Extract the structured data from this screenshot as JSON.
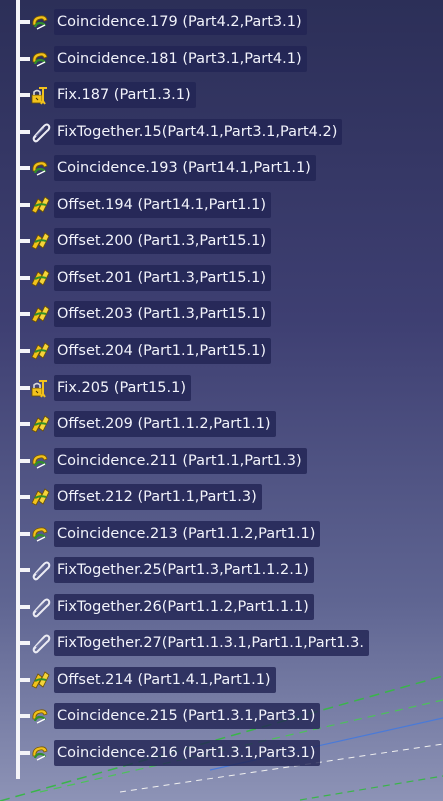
{
  "tree": {
    "items": [
      {
        "type": "coincidence",
        "label": "Coincidence.179 (Part4.2,Part3.1)"
      },
      {
        "type": "coincidence",
        "label": "Coincidence.181 (Part3.1,Part4.1)"
      },
      {
        "type": "fix",
        "label": "Fix.187 (Part1.3.1)"
      },
      {
        "type": "fixtogether",
        "label": "FixTogether.15(Part4.1,Part3.1,Part4.2)"
      },
      {
        "type": "coincidence",
        "label": "Coincidence.193 (Part14.1,Part1.1)"
      },
      {
        "type": "offset",
        "label": "Offset.194 (Part14.1,Part1.1)"
      },
      {
        "type": "offset",
        "label": "Offset.200 (Part1.3,Part15.1)"
      },
      {
        "type": "offset",
        "label": "Offset.201 (Part1.3,Part15.1)"
      },
      {
        "type": "offset",
        "label": "Offset.203 (Part1.3,Part15.1)"
      },
      {
        "type": "offset",
        "label": "Offset.204 (Part1.1,Part15.1)"
      },
      {
        "type": "fix",
        "label": "Fix.205 (Part15.1)"
      },
      {
        "type": "offset",
        "label": "Offset.209 (Part1.1.2,Part1.1)"
      },
      {
        "type": "coincidence",
        "label": "Coincidence.211 (Part1.1,Part1.3)"
      },
      {
        "type": "offset",
        "label": "Offset.212 (Part1.1,Part1.3)"
      },
      {
        "type": "coincidence",
        "label": "Coincidence.213 (Part1.1.2,Part1.1)"
      },
      {
        "type": "fixtogether",
        "label": "FixTogether.25(Part1.3,Part1.1.2.1)"
      },
      {
        "type": "fixtogether",
        "label": "FixTogether.26(Part1.1.2,Part1.1.1)"
      },
      {
        "type": "fixtogether",
        "label": "FixTogether.27(Part1.1.3.1,Part1.1,Part1.3."
      },
      {
        "type": "offset",
        "label": "Offset.214 (Part1.4.1,Part1.1)"
      },
      {
        "type": "coincidence",
        "label": "Coincidence.215 (Part1.3.1,Part3.1)"
      },
      {
        "type": "coincidence",
        "label": "Coincidence.216 (Part1.3.1,Part3.1)"
      }
    ]
  },
  "icons": {
    "coincidence": "coincidence-constraint-icon",
    "offset": "offset-constraint-icon",
    "fix": "fix-constraint-icon",
    "fixtogether": "fix-together-icon"
  },
  "colors": {
    "background_top": "#2c2f58",
    "background_bottom": "#8d93b6",
    "label_background": "#222454",
    "label_text": "#f2f3fb",
    "tree_line": "#f4f4f8",
    "icon_yellow": "#f2c21c",
    "icon_green": "#3a9a2f"
  }
}
